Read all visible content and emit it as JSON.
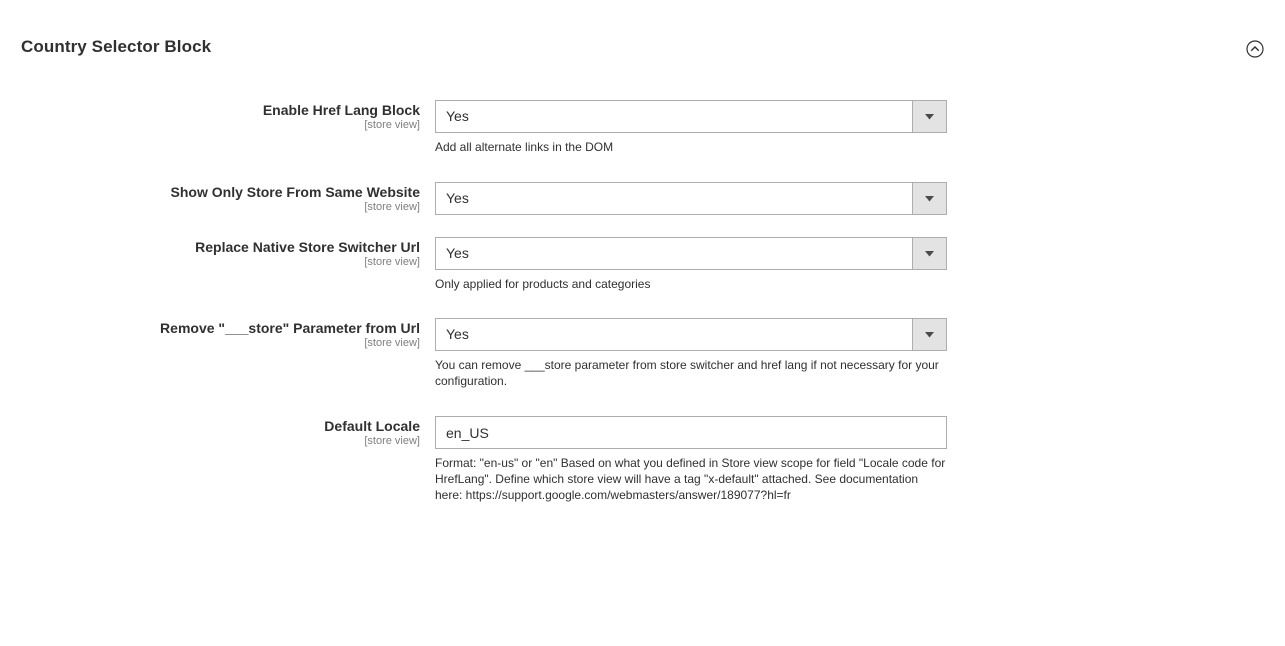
{
  "section": {
    "title": "Country Selector Block",
    "toggle_icon": "chevron-up-circle-icon"
  },
  "fields": [
    {
      "label": "Enable Href Lang Block",
      "scope": "[store view]",
      "type": "select",
      "value": "Yes",
      "note": "Add all alternate links in the DOM"
    },
    {
      "label": "Show Only Store From Same Website",
      "scope": "[store view]",
      "type": "select",
      "value": "Yes",
      "note": ""
    },
    {
      "label": "Replace Native Store Switcher Url",
      "scope": "[store view]",
      "type": "select",
      "value": "Yes",
      "note": "Only applied for products and categories"
    },
    {
      "label": "Remove \"___store\" Parameter from Url",
      "scope": "[store view]",
      "type": "select",
      "value": "Yes",
      "note": "You can remove ___store parameter from store switcher and href lang if not necessary for your configuration."
    },
    {
      "label": "Default Locale",
      "scope": "[store view]",
      "type": "text",
      "value": "en_US",
      "note": "Format: \"en-us\" or \"en\" Based on what you defined in Store view scope for field \"Locale code for HrefLang\". Define which store view will have a tag \"x-default\" attached. See documentation here: https://support.google.com/webmasters/answer/189077?hl=fr"
    }
  ]
}
